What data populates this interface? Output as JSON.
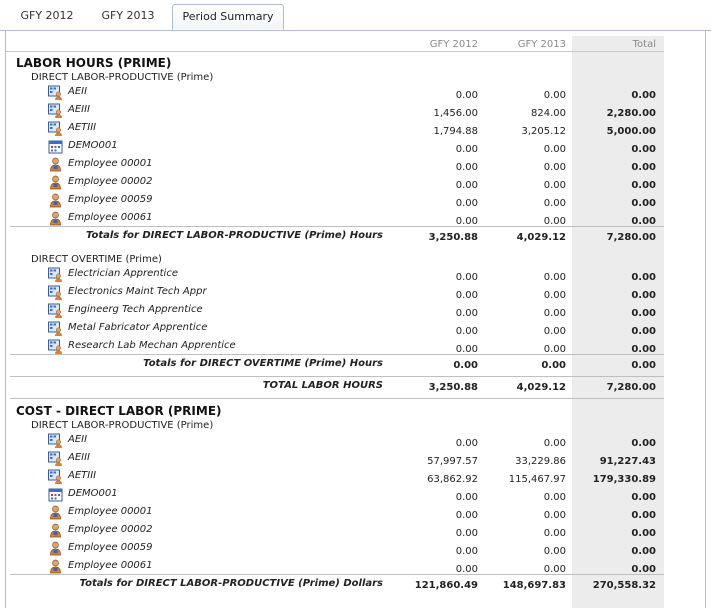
{
  "tabs": [
    {
      "label": "GFY 2012",
      "active": false
    },
    {
      "label": "GFY 2013",
      "active": false
    },
    {
      "label": "Period Summary",
      "active": true
    }
  ],
  "columns": [
    "GFY 2012",
    "GFY 2013",
    "Total"
  ],
  "sections": [
    {
      "title": "LABOR HOURS (PRIME)",
      "groups": [
        {
          "title": "DIRECT LABOR-PRODUCTIVE (Prime)",
          "rows": [
            {
              "icon": "group-icon",
              "name": "AEII",
              "v1": "0.00",
              "v2": "0.00",
              "total": "0.00"
            },
            {
              "icon": "group-icon",
              "name": "AEIII",
              "v1": "1,456.00",
              "v2": "824.00",
              "total": "2,280.00"
            },
            {
              "icon": "group-icon",
              "name": "AETIII",
              "v1": "1,794.88",
              "v2": "3,205.12",
              "total": "5,000.00"
            },
            {
              "icon": "calendar-icon",
              "name": "DEMO001",
              "v1": "0.00",
              "v2": "0.00",
              "total": "0.00"
            },
            {
              "icon": "person-icon",
              "name": "Employee 00001",
              "v1": "0.00",
              "v2": "0.00",
              "total": "0.00"
            },
            {
              "icon": "person-icon",
              "name": "Employee 00002",
              "v1": "0.00",
              "v2": "0.00",
              "total": "0.00"
            },
            {
              "icon": "person-icon",
              "name": "Employee 00059",
              "v1": "0.00",
              "v2": "0.00",
              "total": "0.00"
            },
            {
              "icon": "person-icon",
              "name": "Employee 00061",
              "v1": "0.00",
              "v2": "0.00",
              "total": "0.00"
            }
          ],
          "total_label": "Totals for DIRECT LABOR-PRODUCTIVE (Prime) Hours",
          "total_v1": "3,250.88",
          "total_v2": "4,029.12",
          "total_total": "7,280.00"
        },
        {
          "title": "DIRECT OVERTIME (Prime)",
          "rows": [
            {
              "icon": "group-icon",
              "name": "Electrician Apprentice",
              "v1": "0.00",
              "v2": "0.00",
              "total": "0.00"
            },
            {
              "icon": "group-icon",
              "name": "Electronics Maint Tech Appr",
              "v1": "0.00",
              "v2": "0.00",
              "total": "0.00"
            },
            {
              "icon": "group-icon",
              "name": "Engineerg Tech Apprentice",
              "v1": "0.00",
              "v2": "0.00",
              "total": "0.00"
            },
            {
              "icon": "group-icon",
              "name": "Metal Fabricator Apprentice",
              "v1": "0.00",
              "v2": "0.00",
              "total": "0.00"
            },
            {
              "icon": "group-icon",
              "name": "Research Lab Mechan Apprentice",
              "v1": "0.00",
              "v2": "0.00",
              "total": "0.00"
            }
          ],
          "total_label": "Totals for DIRECT OVERTIME (Prime) Hours",
          "total_v1": "0.00",
          "total_v2": "0.00",
          "total_total": "0.00"
        }
      ],
      "grand_label": "TOTAL LABOR HOURS",
      "grand_v1": "3,250.88",
      "grand_v2": "4,029.12",
      "grand_total": "7,280.00"
    },
    {
      "title": "COST - DIRECT LABOR (PRIME)",
      "groups": [
        {
          "title": "DIRECT LABOR-PRODUCTIVE (Prime)",
          "rows": [
            {
              "icon": "group-icon",
              "name": "AEII",
              "v1": "0.00",
              "v2": "0.00",
              "total": "0.00"
            },
            {
              "icon": "group-icon",
              "name": "AEIII",
              "v1": "57,997.57",
              "v2": "33,229.86",
              "total": "91,227.43"
            },
            {
              "icon": "group-icon",
              "name": "AETIII",
              "v1": "63,862.92",
              "v2": "115,467.97",
              "total": "179,330.89"
            },
            {
              "icon": "calendar-icon",
              "name": "DEMO001",
              "v1": "0.00",
              "v2": "0.00",
              "total": "0.00"
            },
            {
              "icon": "person-icon",
              "name": "Employee 00001",
              "v1": "0.00",
              "v2": "0.00",
              "total": "0.00"
            },
            {
              "icon": "person-icon",
              "name": "Employee 00002",
              "v1": "0.00",
              "v2": "0.00",
              "total": "0.00"
            },
            {
              "icon": "person-icon",
              "name": "Employee 00059",
              "v1": "0.00",
              "v2": "0.00",
              "total": "0.00"
            },
            {
              "icon": "person-icon",
              "name": "Employee 00061",
              "v1": "0.00",
              "v2": "0.00",
              "total": "0.00"
            }
          ],
          "total_label": "Totals for DIRECT LABOR-PRODUCTIVE (Prime) Dollars",
          "total_v1": "121,860.49",
          "total_v2": "148,697.83",
          "total_total": "270,558.32"
        }
      ]
    }
  ]
}
